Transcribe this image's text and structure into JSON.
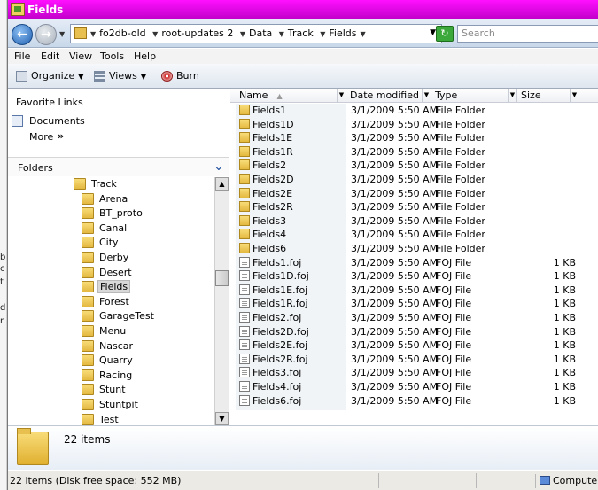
{
  "window": {
    "title": "Fields"
  },
  "address": {
    "crumbs": [
      "fo2db-old",
      "root-updates 2",
      "Data",
      "Track",
      "Fields"
    ],
    "search_placeholder": "Search"
  },
  "menu": [
    "File",
    "Edit",
    "View",
    "Tools",
    "Help"
  ],
  "toolbar": {
    "organize": "Organize",
    "views": "Views",
    "burn": "Burn"
  },
  "nav": {
    "favorite_links": "Favorite Links",
    "favorites": [
      "Documents"
    ],
    "more": "More",
    "more_chevron": "»",
    "folders": "Folders",
    "tree": [
      "Track",
      "Arena",
      "BT_proto",
      "Canal",
      "City",
      "Derby",
      "Desert",
      "Fields",
      "Forest",
      "GarageTest",
      "Menu",
      "Nascar",
      "Quarry",
      "Racing",
      "Stunt",
      "Stuntpit",
      "Test"
    ],
    "selected": "Fields"
  },
  "columns": {
    "name": "Name",
    "date": "Date modified",
    "type": "Type",
    "size": "Size"
  },
  "files": [
    {
      "name": "Fields1",
      "date": "3/1/2009 5:50 AM",
      "type": "File Folder",
      "size": "",
      "kind": "folder"
    },
    {
      "name": "Fields1D",
      "date": "3/1/2009 5:50 AM",
      "type": "File Folder",
      "size": "",
      "kind": "folder"
    },
    {
      "name": "Fields1E",
      "date": "3/1/2009 5:50 AM",
      "type": "File Folder",
      "size": "",
      "kind": "folder"
    },
    {
      "name": "Fields1R",
      "date": "3/1/2009 5:50 AM",
      "type": "File Folder",
      "size": "",
      "kind": "folder"
    },
    {
      "name": "Fields2",
      "date": "3/1/2009 5:50 AM",
      "type": "File Folder",
      "size": "",
      "kind": "folder"
    },
    {
      "name": "Fields2D",
      "date": "3/1/2009 5:50 AM",
      "type": "File Folder",
      "size": "",
      "kind": "folder"
    },
    {
      "name": "Fields2E",
      "date": "3/1/2009 5:50 AM",
      "type": "File Folder",
      "size": "",
      "kind": "folder"
    },
    {
      "name": "Fields2R",
      "date": "3/1/2009 5:50 AM",
      "type": "File Folder",
      "size": "",
      "kind": "folder"
    },
    {
      "name": "Fields3",
      "date": "3/1/2009 5:50 AM",
      "type": "File Folder",
      "size": "",
      "kind": "folder"
    },
    {
      "name": "Fields4",
      "date": "3/1/2009 5:50 AM",
      "type": "File Folder",
      "size": "",
      "kind": "folder"
    },
    {
      "name": "Fields6",
      "date": "3/1/2009 5:50 AM",
      "type": "File Folder",
      "size": "",
      "kind": "folder"
    },
    {
      "name": "Fields1.foj",
      "date": "3/1/2009 5:50 AM",
      "type": "FOJ File",
      "size": "1 KB",
      "kind": "file"
    },
    {
      "name": "Fields1D.foj",
      "date": "3/1/2009 5:50 AM",
      "type": "FOJ File",
      "size": "1 KB",
      "kind": "file"
    },
    {
      "name": "Fields1E.foj",
      "date": "3/1/2009 5:50 AM",
      "type": "FOJ File",
      "size": "1 KB",
      "kind": "file"
    },
    {
      "name": "Fields1R.foj",
      "date": "3/1/2009 5:50 AM",
      "type": "FOJ File",
      "size": "1 KB",
      "kind": "file"
    },
    {
      "name": "Fields2.foj",
      "date": "3/1/2009 5:50 AM",
      "type": "FOJ File",
      "size": "1 KB",
      "kind": "file"
    },
    {
      "name": "Fields2D.foj",
      "date": "3/1/2009 5:50 AM",
      "type": "FOJ File",
      "size": "1 KB",
      "kind": "file"
    },
    {
      "name": "Fields2E.foj",
      "date": "3/1/2009 5:50 AM",
      "type": "FOJ File",
      "size": "1 KB",
      "kind": "file"
    },
    {
      "name": "Fields2R.foj",
      "date": "3/1/2009 5:50 AM",
      "type": "FOJ File",
      "size": "1 KB",
      "kind": "file"
    },
    {
      "name": "Fields3.foj",
      "date": "3/1/2009 5:50 AM",
      "type": "FOJ File",
      "size": "1 KB",
      "kind": "file"
    },
    {
      "name": "Fields4.foj",
      "date": "3/1/2009 5:50 AM",
      "type": "FOJ File",
      "size": "1 KB",
      "kind": "file"
    },
    {
      "name": "Fields6.foj",
      "date": "3/1/2009 5:50 AM",
      "type": "FOJ File",
      "size": "1 KB",
      "kind": "file"
    }
  ],
  "details": {
    "count": "22 items"
  },
  "status": {
    "text": "22 items (Disk free space: 552 MB)",
    "location": "Computer"
  },
  "background_window_chars": [
    "b",
    "c",
    "t",
    "d",
    "r"
  ]
}
